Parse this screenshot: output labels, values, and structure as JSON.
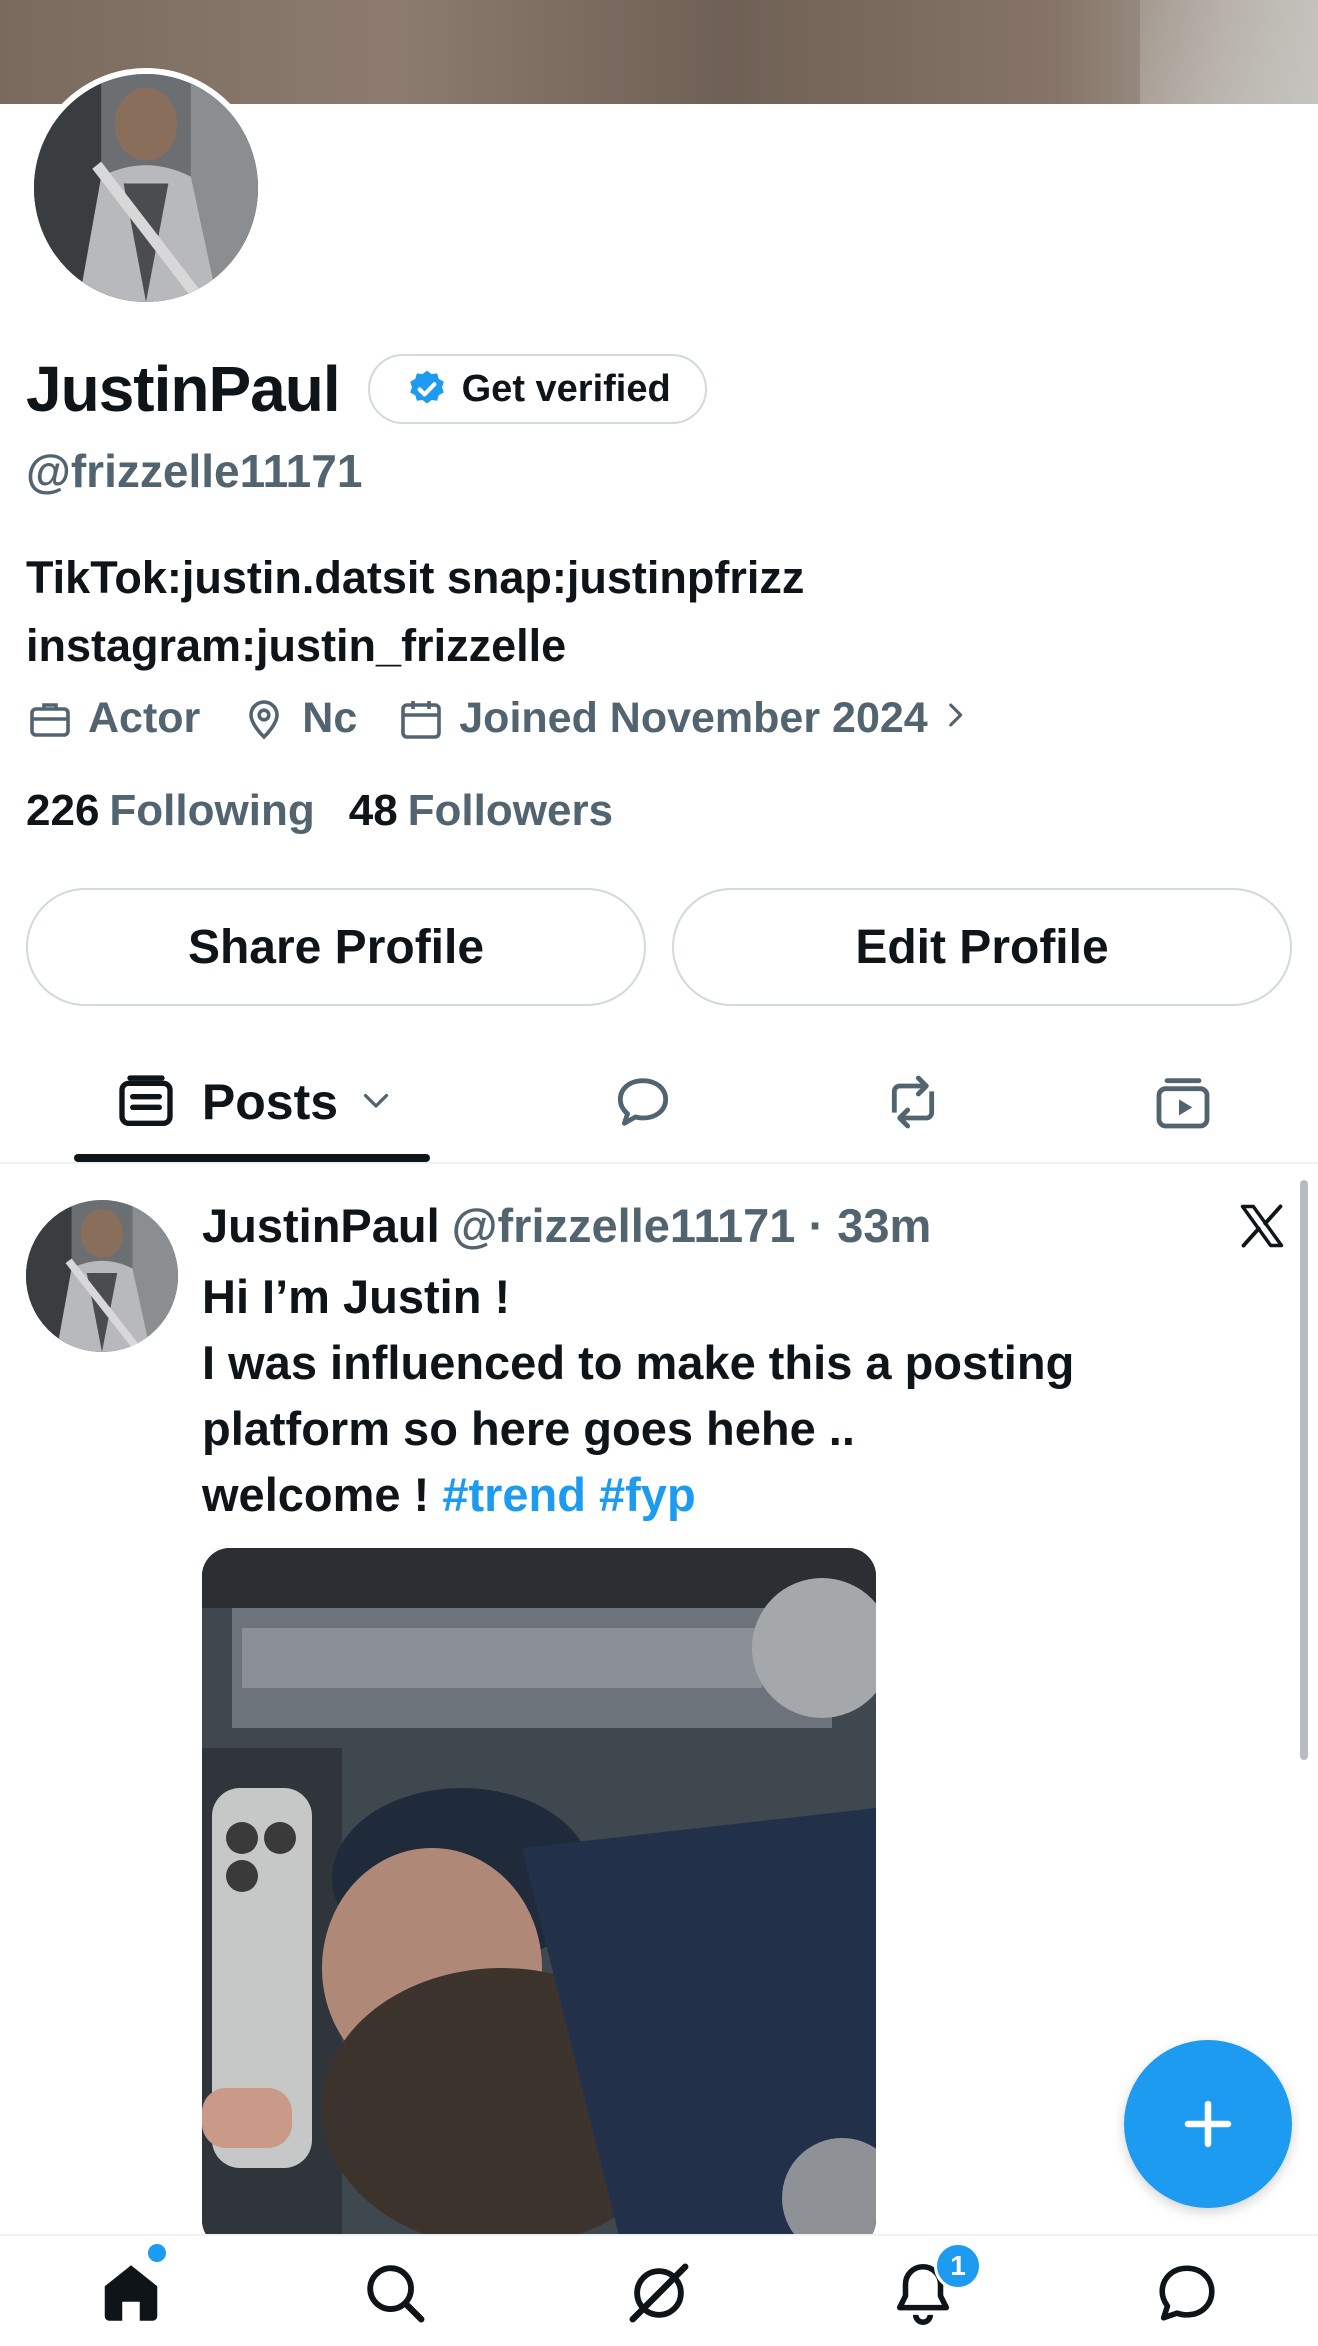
{
  "profile": {
    "display_name": "JustinPaul",
    "verify_label": "Get verified",
    "handle": "@frizzelle11171",
    "bio_line1": "TikTok:justin.datsit snap:justinpfrizz",
    "bio_line2": "instagram:justin_frizzelle",
    "occupation": "Actor",
    "location": "Nc",
    "joined": "Joined November 2024",
    "following_count": "226",
    "following_label": "Following",
    "followers_count": "48",
    "followers_label": "Followers"
  },
  "buttons": {
    "share": "Share Profile",
    "edit": "Edit Profile"
  },
  "tabs": {
    "posts": "Posts",
    "icons": [
      "posts-icon",
      "replies-icon",
      "reposts-icon",
      "media-icon"
    ]
  },
  "post": {
    "name": "JustinPaul",
    "handle": "@frizzelle11171",
    "dot": "·",
    "time": "33m",
    "line1": "Hi I’m Justin !",
    "line2": "I was influenced to make this a posting",
    "line3": "platform so here goes hehe ..",
    "line4_text": "welcome ! ",
    "hashtag1": "#trend",
    "hashtag2": "#fyp"
  },
  "nav": {
    "items": [
      "home-icon",
      "search-icon",
      "grok-icon",
      "notifications-icon",
      "messages-icon"
    ],
    "notification_count": "1"
  },
  "colors": {
    "accent": "#1d9bf0",
    "text_primary": "#0f1419",
    "text_secondary": "#536471",
    "border": "#cfd9de"
  }
}
